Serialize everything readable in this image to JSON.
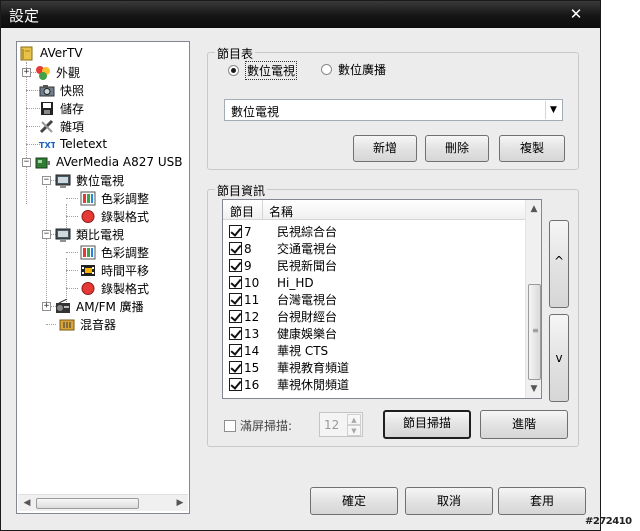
{
  "window": {
    "title": "設定",
    "close_glyph": "✕"
  },
  "tree": {
    "items": [
      {
        "label": "AVerTV",
        "icon": "book-icon"
      },
      {
        "label": "外觀",
        "icon": "palette-icon",
        "expander": "+"
      },
      {
        "label": "快照",
        "icon": "camera-icon"
      },
      {
        "label": "儲存",
        "icon": "floppy-icon"
      },
      {
        "label": "雜項",
        "icon": "tools-icon"
      },
      {
        "label": "Teletext",
        "icon": "teletext-icon"
      },
      {
        "label": "AVerMedia A827 USB",
        "icon": "device-icon",
        "expander": "−"
      },
      {
        "label": "數位電視",
        "icon": "tv-icon",
        "expander": "−"
      },
      {
        "label": "色彩調整",
        "icon": "color-adjust-icon"
      },
      {
        "label": "錄製格式",
        "icon": "record-icon"
      },
      {
        "label": "類比電視",
        "icon": "tv-icon",
        "expander": "−"
      },
      {
        "label": "色彩調整",
        "icon": "color-adjust-icon"
      },
      {
        "label": "時間平移",
        "icon": "timeshift-icon"
      },
      {
        "label": "錄製格式",
        "icon": "record-icon"
      },
      {
        "label": "AM/FM 廣播",
        "icon": "radio-icon",
        "expander": "+"
      },
      {
        "label": "混音器",
        "icon": "mixer-icon"
      }
    ]
  },
  "program_table": {
    "group_label": "節目表",
    "radio_digital": "數位電視",
    "radio_broadcast": "數位廣播",
    "selected": "數位電視",
    "combo_value": "數位電視",
    "add_label": "新增",
    "delete_label": "刪除",
    "copy_label": "複製"
  },
  "program_info": {
    "group_label": "節目資訊",
    "columns": [
      "節目",
      "名稱"
    ],
    "rows": [
      {
        "num": "7",
        "name": "民視綜合台",
        "checked": true
      },
      {
        "num": "8",
        "name": "交通電視台",
        "checked": true
      },
      {
        "num": "9",
        "name": "民視新聞台",
        "checked": true
      },
      {
        "num": "10",
        "name": "Hi_HD",
        "checked": true
      },
      {
        "num": "11",
        "name": "台灣電視台",
        "checked": true
      },
      {
        "num": "12",
        "name": "台視財經台",
        "checked": true
      },
      {
        "num": "13",
        "name": "健康娛樂台",
        "checked": true
      },
      {
        "num": "14",
        "name": "華視 CTS",
        "checked": true
      },
      {
        "num": "15",
        "name": "華視教育頻道",
        "checked": true
      },
      {
        "num": "16",
        "name": "華視休閒頻道",
        "checked": true
      }
    ],
    "move_up_label": "^",
    "move_down_label": "v",
    "fullscreen_scan_label": "滿屏掃描:",
    "scan_count": "12",
    "scan_button_label": "節目掃描",
    "advanced_label": "進階"
  },
  "footer": {
    "ok_label": "確定",
    "cancel_label": "取消",
    "apply_label": "套用"
  },
  "watermark": "#272410"
}
